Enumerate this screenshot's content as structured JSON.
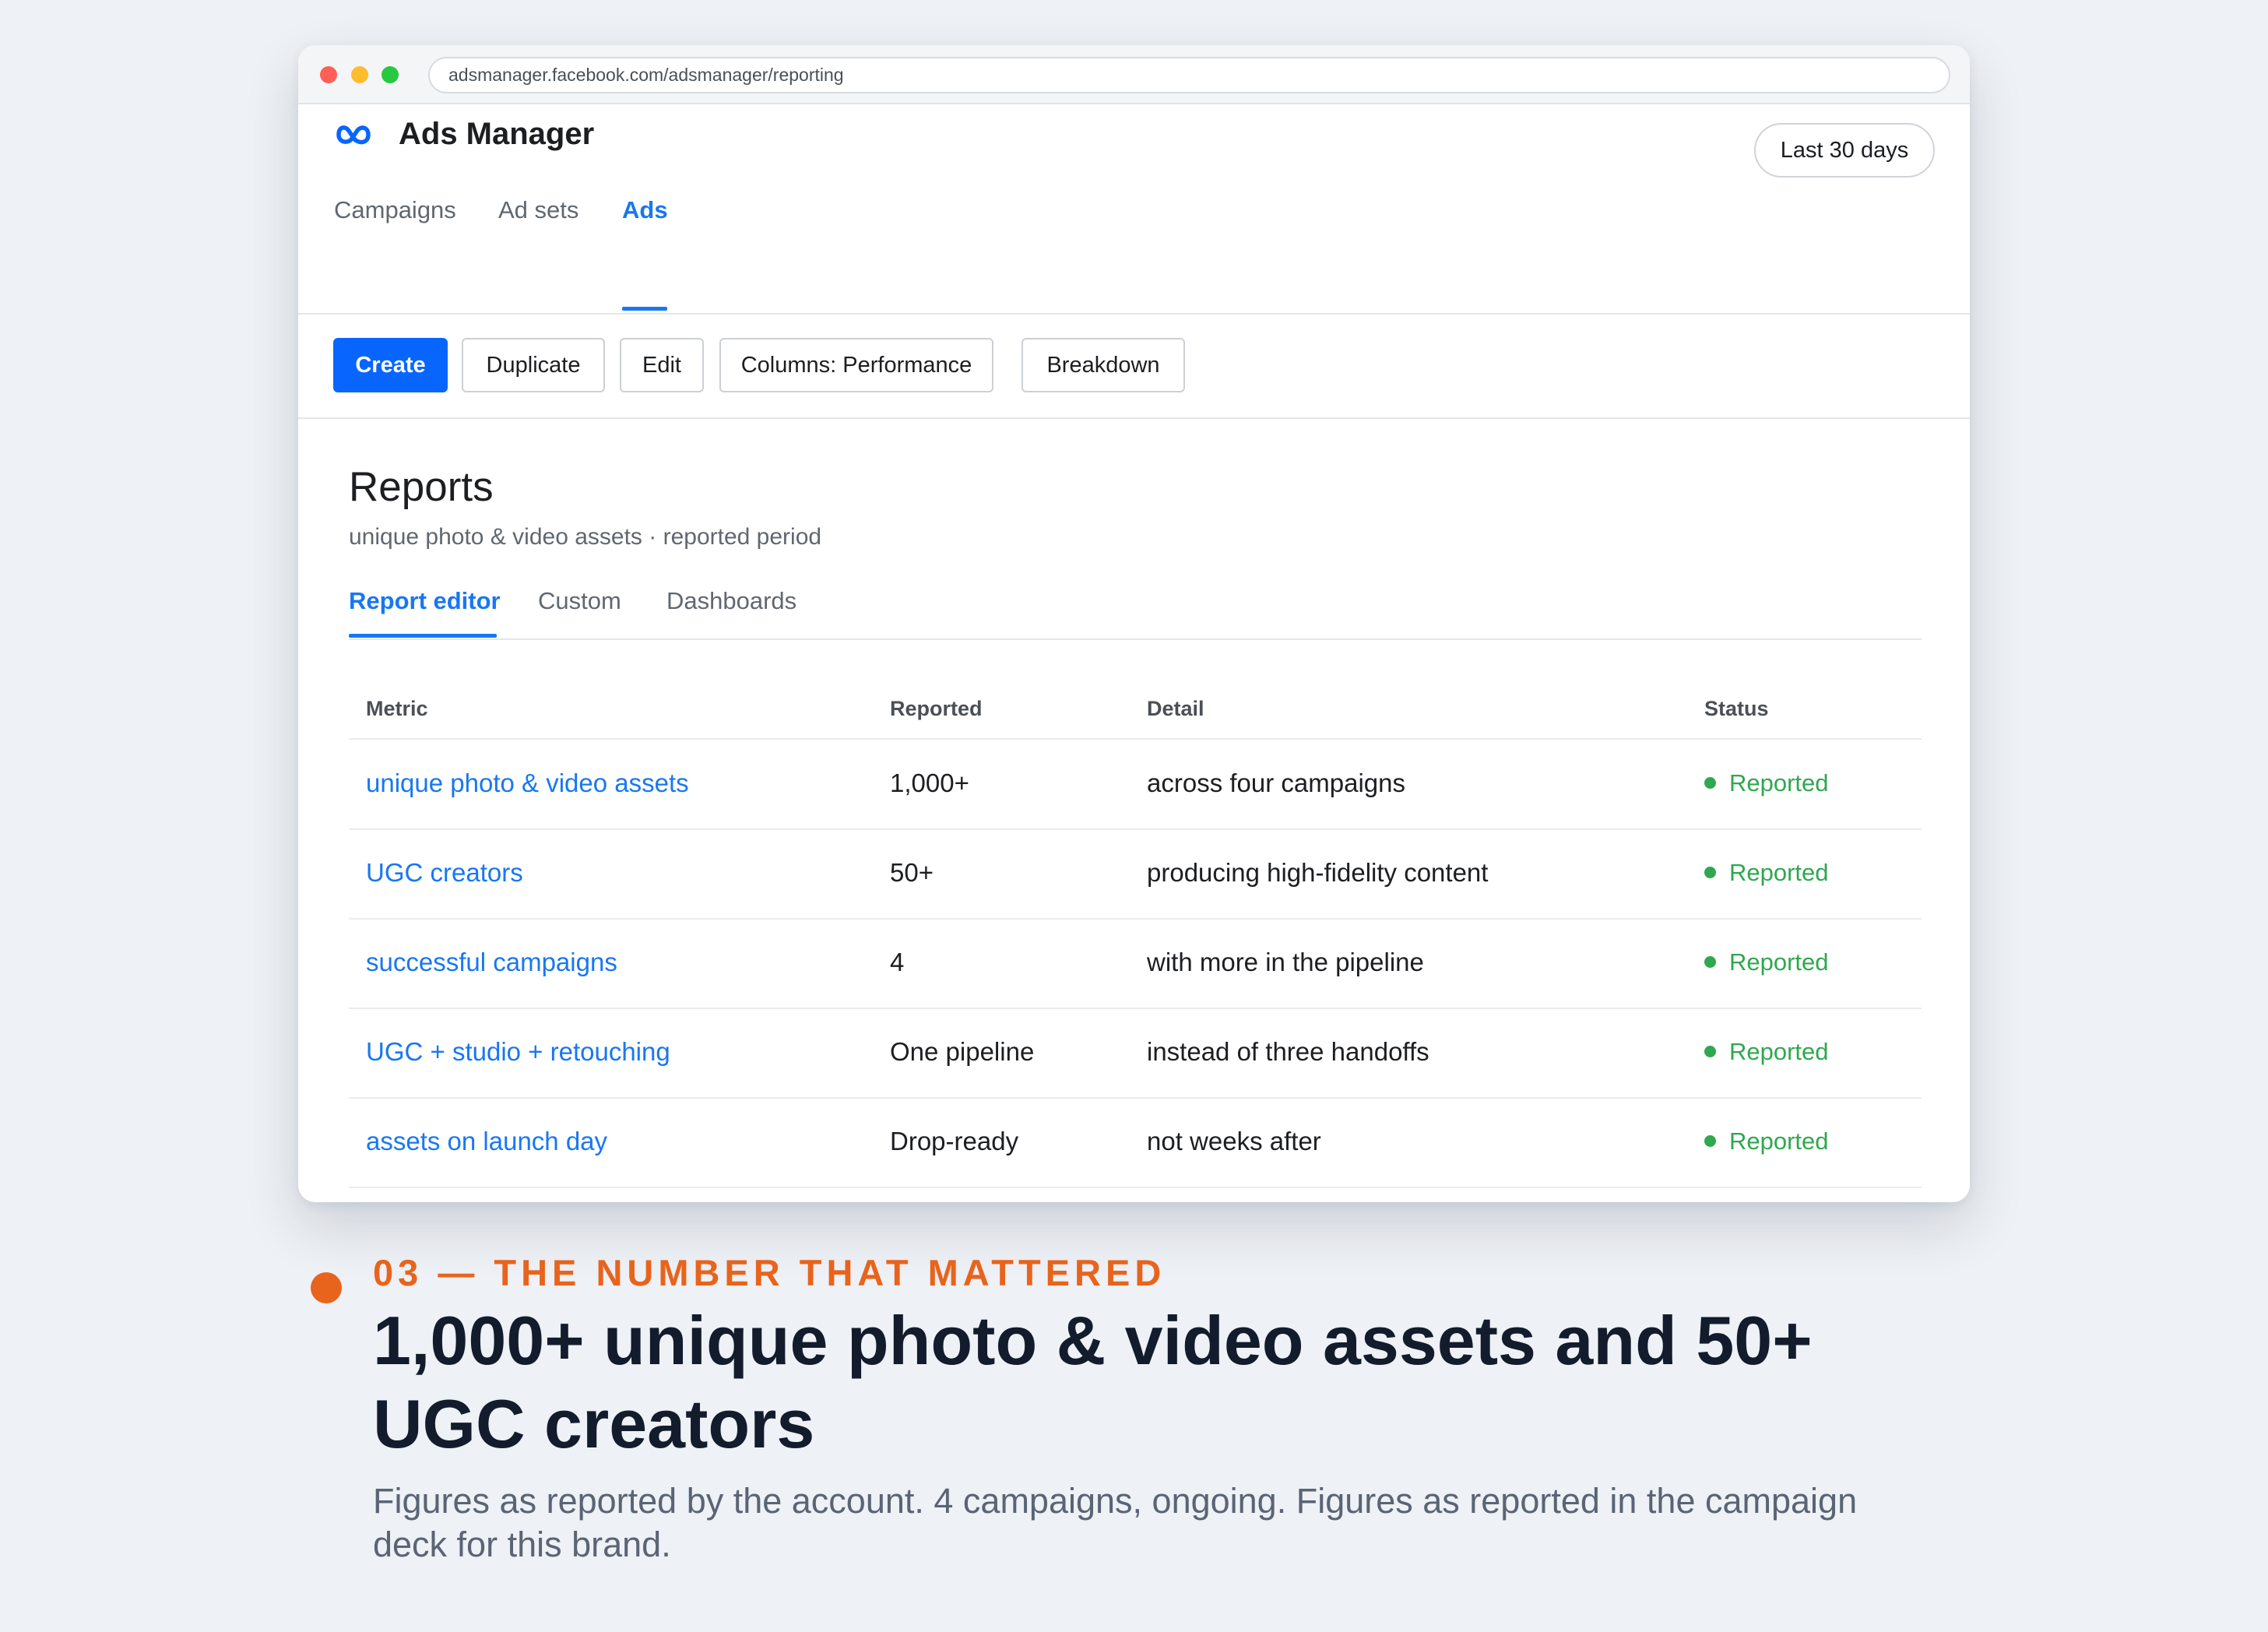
{
  "browser": {
    "url": "adsmanager.facebook.com/adsmanager/reporting"
  },
  "app": {
    "title": "Ads Manager",
    "logo_icon": "meta-logo-icon",
    "brand_color": "#0866ff"
  },
  "date_range": {
    "label": "Last 30 days"
  },
  "nav": {
    "tabs": [
      {
        "label": "Campaigns"
      },
      {
        "label": "Ad sets"
      },
      {
        "label": "Ads",
        "active": true
      }
    ]
  },
  "toolbar": {
    "create": "Create",
    "duplicate": "Duplicate",
    "edit": "Edit",
    "columns": "Columns: Performance",
    "breakdown": "Breakdown"
  },
  "reports": {
    "title": "Reports",
    "subtitle": "unique photo & video assets · reported period",
    "tabs": [
      {
        "label": "Report editor",
        "active": true
      },
      {
        "label": "Custom"
      },
      {
        "label": "Dashboards"
      }
    ]
  },
  "table": {
    "headers": {
      "metric": "Metric",
      "reported": "Reported",
      "detail": "Detail",
      "status": "Status"
    },
    "rows": [
      {
        "metric": "unique photo & video assets",
        "reported": "1,000+",
        "detail": "across four campaigns",
        "status": "Reported"
      },
      {
        "metric": "UGC creators",
        "reported": "50+",
        "detail": "producing high-fidelity content",
        "status": "Reported"
      },
      {
        "metric": "successful campaigns",
        "reported": "4",
        "detail": "with more in the pipeline",
        "status": "Reported"
      },
      {
        "metric": "UGC + studio + retouching",
        "reported": "One pipeline",
        "detail": "instead of three handoffs",
        "status": "Reported"
      },
      {
        "metric": "assets on launch day",
        "reported": "Drop-ready",
        "detail": "not weeks after",
        "status": "Reported"
      }
    ],
    "status_color": "#2fa84f"
  },
  "callout": {
    "eyebrow": "03 — THE NUMBER THAT MATTERED",
    "headline": "1,000+ unique photo & video assets and 50+ UGC creators",
    "caption": "Figures as reported by the account. 4 campaigns, ongoing. Figures as reported in the campaign deck for this brand.",
    "accent_color": "#e8641c"
  }
}
